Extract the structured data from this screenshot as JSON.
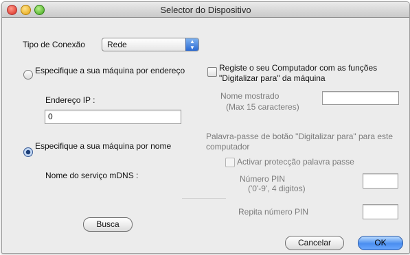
{
  "window": {
    "title": "Selector do Dispositivo"
  },
  "connection": {
    "label": "Tipo de Conexão",
    "selected": "Rede"
  },
  "left": {
    "radio_address_label": "Especifique a sua máquina por endereço",
    "ip_label": "Endereço IP :",
    "ip_value": "0",
    "radio_name_label": "Especifique a sua máquina por nome",
    "mdns_label": "Nome do serviço mDNS :",
    "browse_button": "Busca"
  },
  "right": {
    "register_label": "Registe o seu Computador com as funções \"Digitalizar para\" da máquina",
    "display_name_label": "Nome mostrado",
    "display_name_hint": "(Max 15 caracteres)",
    "password_heading": "Palavra-passe de botão \"Digitalizar para\" para este computador",
    "activate_protection_label": "Activar protecção palavra passe",
    "pin_label": "Número PIN",
    "pin_hint": "('0'-9', 4 digitos)",
    "repeat_pin_label": "Repita número PIN"
  },
  "footer": {
    "cancel_button": "Cancelar",
    "ok_button": "OK"
  }
}
